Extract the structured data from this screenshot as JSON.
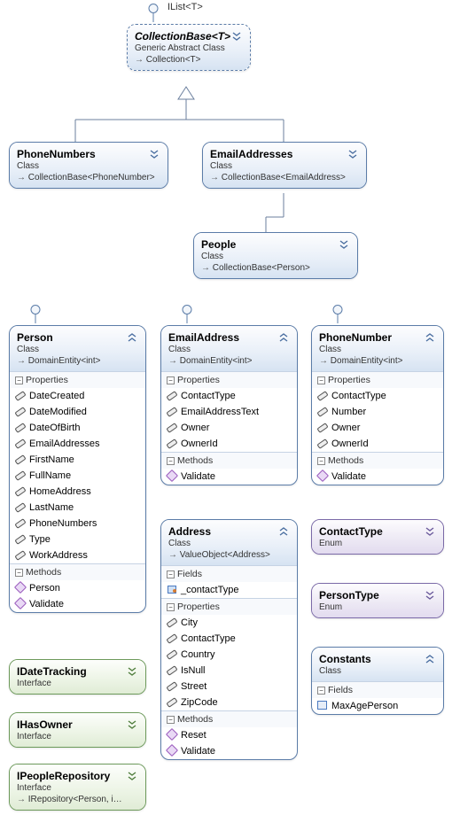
{
  "iface_ilist": "IList<T>",
  "collectionbase": {
    "title": "CollectionBase<T>",
    "kind": "Generic Abstract Class",
    "inherit": "Collection<T>"
  },
  "phonenumbers_coll": {
    "title": "PhoneNumbers",
    "kind": "Class",
    "inherit": "CollectionBase<PhoneNumber>"
  },
  "emailaddresses_coll": {
    "title": "EmailAddresses",
    "kind": "Class",
    "inherit": "CollectionBase<EmailAddress>"
  },
  "people_coll": {
    "title": "People",
    "kind": "Class",
    "inherit": "CollectionBase<Person>"
  },
  "sections": {
    "properties": "Properties",
    "methods": "Methods",
    "fields": "Fields"
  },
  "person": {
    "title": "Person",
    "kind": "Class",
    "inherit": "DomainEntity<int>",
    "props": [
      "DateCreated",
      "DateModified",
      "DateOfBirth",
      "EmailAddresses",
      "FirstName",
      "FullName",
      "HomeAddress",
      "LastName",
      "PhoneNumbers",
      "Type",
      "WorkAddress"
    ],
    "methods": [
      "Person",
      "Validate"
    ]
  },
  "emailaddress": {
    "title": "EmailAddress",
    "kind": "Class",
    "inherit": "DomainEntity<int>",
    "props": [
      "ContactType",
      "EmailAddressText",
      "Owner",
      "OwnerId"
    ],
    "methods": [
      "Validate"
    ]
  },
  "phonenumber": {
    "title": "PhoneNumber",
    "kind": "Class",
    "inherit": "DomainEntity<int>",
    "props": [
      "ContactType",
      "Number",
      "Owner",
      "OwnerId"
    ],
    "methods": [
      "Validate"
    ]
  },
  "address": {
    "title": "Address",
    "kind": "Class",
    "inherit": "ValueObject<Address>",
    "fields": [
      "_contactType"
    ],
    "props": [
      "City",
      "ContactType",
      "Country",
      "IsNull",
      "Street",
      "ZipCode"
    ],
    "methods": [
      "Reset",
      "Validate"
    ]
  },
  "contacttype": {
    "title": "ContactType",
    "kind": "Enum"
  },
  "persontype": {
    "title": "PersonType",
    "kind": "Enum"
  },
  "constants": {
    "title": "Constants",
    "kind": "Class",
    "fields": [
      "MaxAgePerson"
    ]
  },
  "idatetracking": {
    "title": "IDateTracking",
    "kind": "Interface"
  },
  "ihasowner": {
    "title": "IHasOwner",
    "kind": "Interface"
  },
  "ipeoplerepo": {
    "title": "IPeopleRepository",
    "kind": "Interface",
    "inherit": "IRepository<Person, i…"
  }
}
